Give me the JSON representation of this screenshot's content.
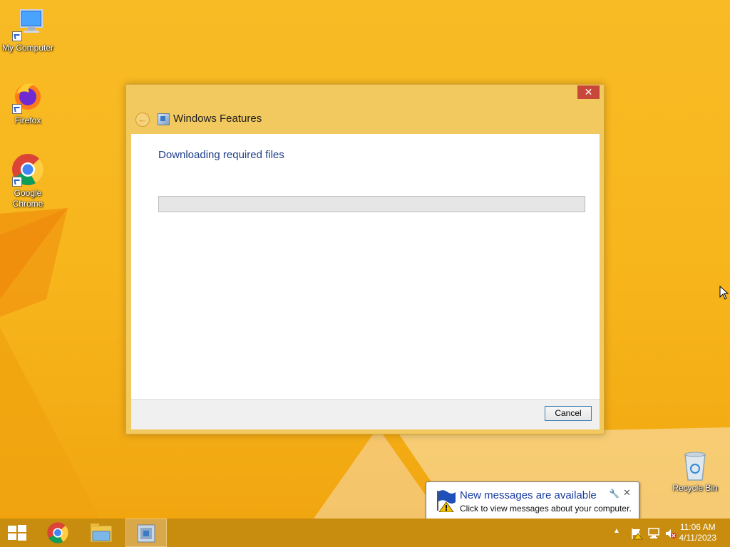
{
  "desktop": {
    "icons": [
      {
        "label": "My Computer",
        "icon": "computer-icon"
      },
      {
        "label": "Firefox",
        "icon": "firefox-icon"
      },
      {
        "label": "Google Chrome",
        "icon": "chrome-icon"
      },
      {
        "label": "Recycle Bin",
        "icon": "recycle-bin-icon"
      }
    ]
  },
  "dialog": {
    "title": "Windows Features",
    "close_label": "✕",
    "status": "Downloading required files",
    "progress": 0,
    "cancel_label": "Cancel"
  },
  "notification": {
    "title": "New messages are available",
    "body": "Click to view messages about your computer."
  },
  "taskbar": {
    "apps": [
      "Google Chrome",
      "File Explorer",
      "Windows Features"
    ],
    "clock": {
      "time": "11:06 AM",
      "date": "4/11/2023"
    }
  },
  "colors": {
    "desktop_bg": "#f7b51b",
    "taskbar_bg": "#c88d0f",
    "dialog_frame": "#f2c95e",
    "close_red": "#c7473a",
    "status_text": "#1f3f8a"
  }
}
